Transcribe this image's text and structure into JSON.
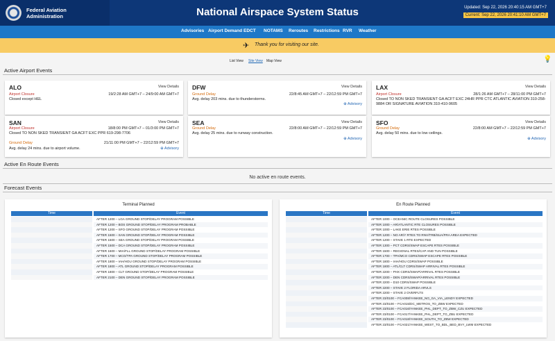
{
  "header": {
    "agency_line1": "Federal Aviation",
    "agency_line2": "Administration",
    "title": "National Airspace System Status",
    "updated": "Updated: Sep 22, 2026 20:40:15 AM GMT+7",
    "current": "Current: Sep 22, 2026 20:41:10 AM GMT+7"
  },
  "nav": [
    "Advisories",
    "Airport Demand",
    "EDCT",
    "NOTAMS",
    "Reroutes",
    "Restrictions",
    "RVR",
    "Weather"
  ],
  "banner": {
    "text": "Thank you for visiting our site."
  },
  "views": [
    "List View",
    "Site View",
    "Map View"
  ],
  "sections": {
    "airport_events": "Active Airport Events",
    "enroute_events": "Active En Route Events",
    "forecast_events": "Forecast Events"
  },
  "cards": [
    {
      "code": "ALO",
      "view_details": "View Details",
      "events": [
        {
          "type": "Airport Closure",
          "time": "19/2:28 AM GMT+7 – 24/9:00 AM GMT+7",
          "desc": "Closed except HEL",
          "advisory": ""
        }
      ]
    },
    {
      "code": "DFW",
      "view_details": "View Details",
      "events": [
        {
          "type": "Ground Delay",
          "time": "22/8:45 AM GMT+7 – 22/12:59 PM GMT+7",
          "desc": "Avg. delay 203 mins. due to thunderstorms.",
          "advisory": "Advisory"
        }
      ]
    },
    {
      "code": "LAX",
      "view_details": "View Details",
      "events": [
        {
          "type": "Airport Closure",
          "time": "28/1:26 AM GMT+7 – 28/11:00 PM GMT+7",
          "desc": "Closed TO NON SKED TRANSIENT GA ACFT EXC 24HR PPR CTC ATLANTIC AVIATION 310-258-9884 OR SIGNATURE AVIATION 310-410-9605",
          "advisory": ""
        }
      ]
    },
    {
      "code": "SAN",
      "view_details": "View Details",
      "events": [
        {
          "type": "Airport Closure",
          "time": "18/8:00 PM GMT+7 – 01/3:00 PM GMT+7",
          "desc": "Closed TO NON SKED TRANSIENT GA ACFT EXC PPR 619-298-7706",
          "advisory": ""
        },
        {
          "type": "Ground Delay",
          "time": "21/11:00 PM GMT+7 – 22/12:59 PM GMT+7",
          "desc": "Avg. delay 24 mins. due to airport volume.",
          "advisory": "Advisory"
        }
      ]
    },
    {
      "code": "SEA",
      "view_details": "View Details",
      "events": [
        {
          "type": "Ground Delay",
          "time": "22/8:00 AM GMT+7 – 22/12:59 PM GMT+7",
          "desc": "Avg. delay 25 mins. due to runway construction.",
          "advisory": "Advisory"
        }
      ]
    },
    {
      "code": "SFO",
      "view_details": "View Details",
      "events": [
        {
          "type": "Ground Delay",
          "time": "22/8:00 AM GMT+7 – 22/12:59 PM GMT+7",
          "desc": "Avg. delay 50 mins. due to low ceilings.",
          "advisory": "Advisory"
        }
      ]
    }
  ],
  "enroute": {
    "no_events": "No active en route events."
  },
  "forecast": {
    "terminal": {
      "title": "Terminal Planned",
      "col_time": "Time",
      "col_event": "Event",
      "rows": [
        "AFTER 1200 – LGA GROUND STOP/DELAY PROGRAM POSSIBLE",
        "AFTER 1200 – BOS GROUND STOP/DELAY PROGRAM PROBABLE",
        "AFTER 1200 – SFO GROUND STOP/DELAY PROGRAM POSSIBLE",
        "AFTER 1500 – SAN GROUND STOP/DELAY PROGRAM POSSIBLE",
        "AFTER 1500 – SEA GROUND STOP/DELAY PROGRAM POSSIBLE",
        "AFTER 1500 – DCA GROUND STOP/DELAY PROGRAM POSSIBLE",
        "AFTER 1600 – MIA/FLL GROUND STOP/DELAY PROGRAM POSSIBLE",
        "AFTER 1700 – MCO/TPA GROUND STOP/DELAY PROGRAM POSSIBLE",
        "AFTER 1800 – IAH/HOU GROUND STOP/DELAY PROGRAM POSSIBLE",
        "AFTER 1800 – ATL GROUND STOP/DELAY PROGRAM POSSIBLE",
        "AFTER 1800 – CLT GROUND STOP/DELAY PROGRAM POSSIBLE",
        "AFTER 2100 – DEN GROUND STOP/DELAY PROGRAM POSSIBLE"
      ]
    },
    "enroute": {
      "title": "En Route Planned",
      "col_time": "Time",
      "col_event": "Event",
      "rows": [
        "AFTER 1000 – OCEANIC ROUTE CLOSURES POSSIBLE",
        "AFTER 1000 – AR/ATLANTIC RTE CLOSURES POSSIBLE",
        "AFTER 1000 – LAKE ERIE RTES POSSIBLE",
        "AFTER 1200 – NO AR/Y RTES TO RNV/TRB/SUA/FRA AREA EXPECTED",
        "AFTER 1200 – STAVE 1 RTE EXPECTED",
        "AFTER 1300 – PCT CDRS/SWAP ESCAPE RTES POSSIBLE",
        "AFTER 1500 – REGIONAL RTES/CAP AND TUN POSSIBLE",
        "AFTER 1700 – TPA/MCO CDRS/SWAP ESCAPE RTES POSSIBLE",
        "AFTER 1800 – IAH/HOU CDRS/SWAP POSSIBLE",
        "AFTER 1800 – ATL/CLT CDRS/SWAP ARRIVAL RTES POSSIBLE",
        "AFTER 2200 – PHX CDRS/SWAP/ARRIVAL RTES POSSIBLE",
        "AFTER 2200 – DEN CDRS/SWAP/ARRIVAL RTES POSSIBLE",
        "AFTER 2200 – D10 CDRS/SWAP POSSIBLE",
        "AFTER 2200 – STAVE 2 FLORIDA ARVLS",
        "AFTER 2200 – STAVE 2 OVERFLTS",
        "AFTER 23/0100 – FCA008/YANKEE_NO_GA_VIA_LENDY EXPECTED",
        "AFTER 23/0100 – FCA015/DC_METROS_TO_ZBW EXPECTED",
        "AFTER 23/0100 – FCA016/YANKEE_PHL_DEPT_TO_ZBW_CZU EXPECTED",
        "AFTER 23/0100 – FCA017/YANKEE_PHL_DEPT_TO_ZBU EXPECTED",
        "AFTER 23/0100 – FCA018/YANKEE_SOUTH_TO_ZBW EXPECTED",
        "AFTER 23/0100 – FCA021/YANKEE_WEST_TO_BDL_BED_BVY_LWM EXPECTED"
      ]
    }
  }
}
